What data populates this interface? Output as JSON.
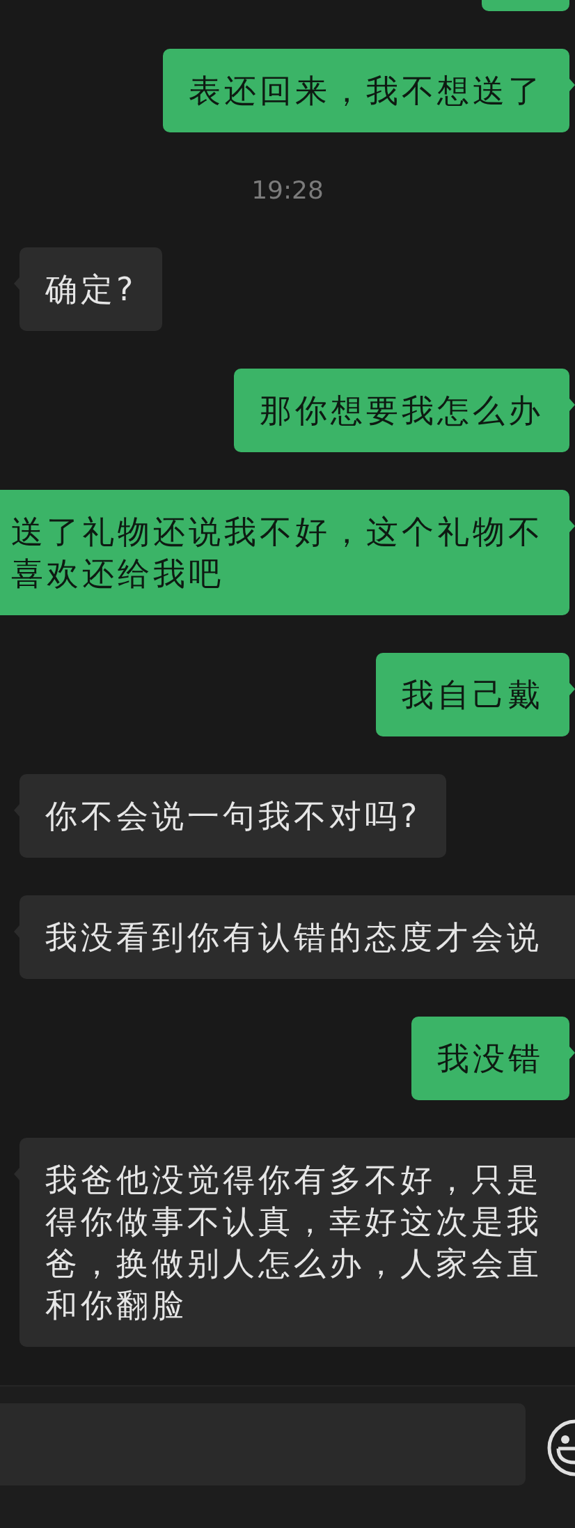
{
  "messages": [
    {
      "kind": "sent_stub"
    },
    {
      "kind": "sent",
      "lines": [
        "表还回来，我不想送了"
      ]
    },
    {
      "kind": "time",
      "text": "19:28"
    },
    {
      "kind": "received",
      "lines": [
        "确定?"
      ]
    },
    {
      "kind": "sent",
      "lines": [
        "那你想要我怎么办"
      ]
    },
    {
      "kind": "sent_cut",
      "lines": [
        "送了礼物还说我不好，这个礼物不",
        "喜欢还给我吧"
      ]
    },
    {
      "kind": "sent",
      "lines": [
        "我自己戴"
      ]
    },
    {
      "kind": "received",
      "lines": [
        "你不会说一句我不对吗?"
      ]
    },
    {
      "kind": "received_cut",
      "lines": [
        "我没看到你有认错的态度才会说"
      ]
    },
    {
      "kind": "sent",
      "lines": [
        "我没错"
      ]
    },
    {
      "kind": "received_cut",
      "lines": [
        "我爸他没觉得你有多不好，只是",
        "得你做事不认真，幸好这次是我",
        "爸，换做别人怎么办，人家会直",
        "和你翻脸"
      ]
    }
  ]
}
